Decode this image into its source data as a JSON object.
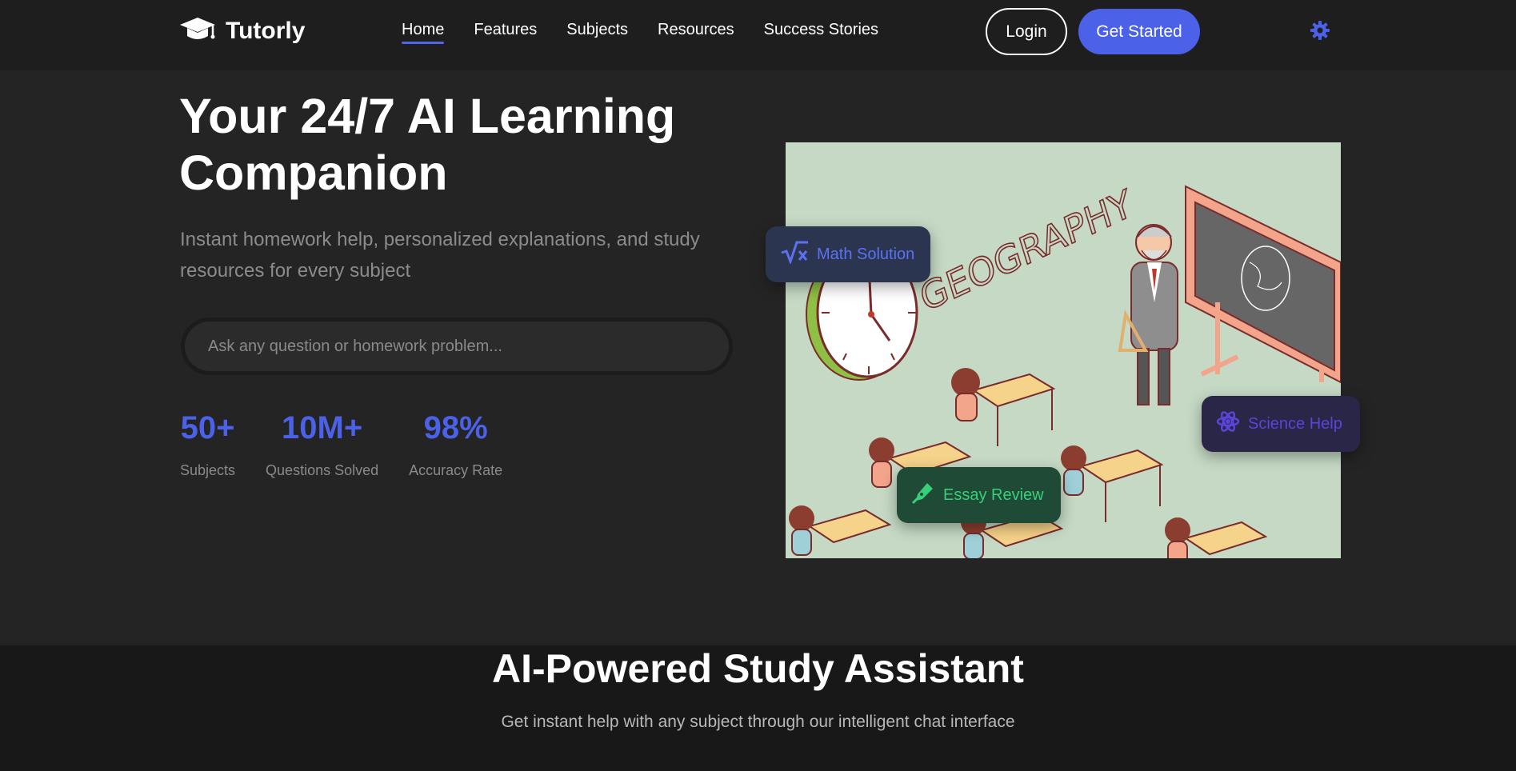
{
  "nav": {
    "brand": "Tutorly",
    "links": [
      {
        "label": "Home",
        "active": true
      },
      {
        "label": "Features",
        "active": false
      },
      {
        "label": "Subjects",
        "active": false
      },
      {
        "label": "Resources",
        "active": false
      },
      {
        "label": "Success Stories",
        "active": false
      }
    ],
    "login_label": "Login",
    "start_label": "Get Started",
    "theme_icon": "gear-icon"
  },
  "hero": {
    "title_line1": "Your 24/7 AI Learning",
    "title_line2": "Companion",
    "subtitle": "Instant homework help, personalized explanations, and study resources for every subject",
    "search_placeholder": "Ask any question or homework problem...",
    "stats": [
      {
        "value": "50+",
        "label": "Subjects"
      },
      {
        "value": "10M+",
        "label": "Questions Solved"
      },
      {
        "value": "98%",
        "label": "Accuracy Rate"
      }
    ]
  },
  "illustration": {
    "board_word": "GEOGRAPHY"
  },
  "float_cards": {
    "math": "Math Solution",
    "science": "Science Help",
    "essay": "Essay Review"
  },
  "section2": {
    "title": "AI-Powered Study Assistant",
    "subtitle": "Get instant help with any subject through our intelligent chat interface"
  },
  "colors": {
    "accent": "#4a61e8",
    "hero_bg": "#242424",
    "nav_bg": "#1e1e1e",
    "illustration_bg": "#c5d9c5"
  }
}
